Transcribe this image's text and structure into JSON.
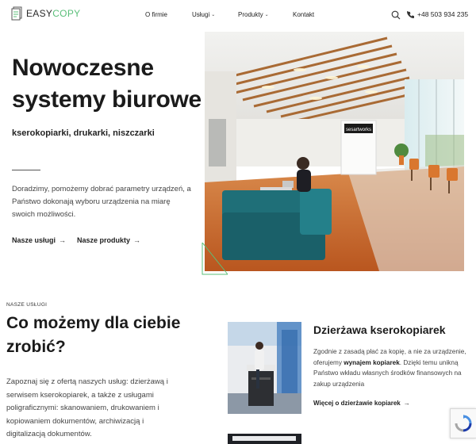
{
  "header": {
    "logo_text_main": "EASY",
    "logo_text_accent": "COPY",
    "nav": [
      {
        "label": "O firmie",
        "has_dropdown": false
      },
      {
        "label": "Usługi",
        "has_dropdown": true
      },
      {
        "label": "Produkty",
        "has_dropdown": true
      },
      {
        "label": "Kontakt",
        "has_dropdown": false
      }
    ],
    "phone": "+48 503 934 235"
  },
  "hero": {
    "title": "Nowoczesne systemy biurowe",
    "subtitle": "kserokopiarki, drukarki, niszczarki",
    "description": "Doradzimy, pomożemy dobrać parametry urządzeń, a Państwo dokonają wyboru urządzenia na miarę swoich możliwości.",
    "links": [
      {
        "label": "Nasze usługi",
        "arrow": "→"
      },
      {
        "label": "Nasze produkty",
        "arrow": "→"
      }
    ],
    "image_sign": "sesartworks"
  },
  "services": {
    "kicker": "NASZE USŁUGI",
    "title": "Co możemy dla ciebie zrobić?",
    "description": "Zapoznaj się z ofertą naszych usług: dzierżawą i serwisem kserokopiarek, a także z usługami poligraficznymi: skanowaniem, drukowaniem i kopiowaniem dokumentów, archiwizacją i digitalizacją dokumentów.",
    "card": {
      "title": "Dzierżawa kserokopiarek",
      "desc_before": "Zgodnie z zasadą płać za kopię, a nie za urządzenie, oferujemy ",
      "desc_bold": "wynajem kopiarek",
      "desc_after": ". Dzięki temu unikną Państwo wkładu własnych środków finansowych na zakup urządzenia",
      "link": "Więcej o dzierżawie kopiarek",
      "arrow": "→"
    }
  },
  "colors": {
    "accent_green": "#5bbf7a",
    "text_dark": "#1b1b1b",
    "text_body": "#444444",
    "sofa_teal": "#1f6f78",
    "floor_orange": "#c8672a"
  }
}
